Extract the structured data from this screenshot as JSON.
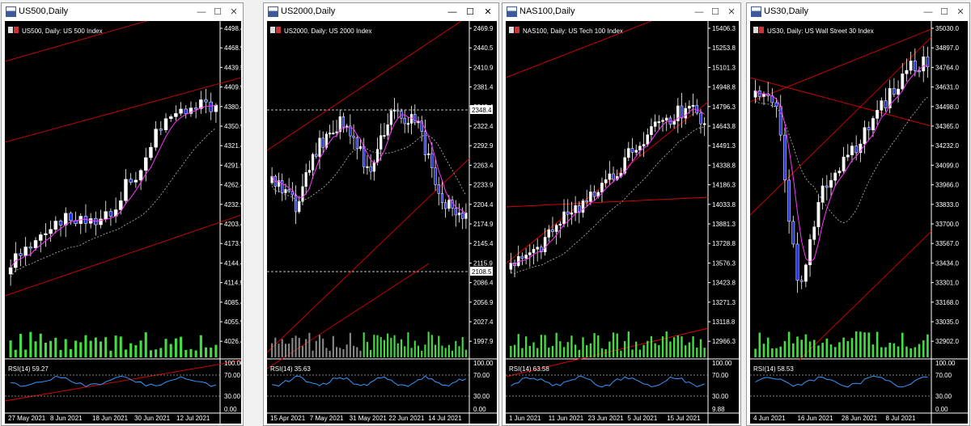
{
  "windows": [
    {
      "title": "US500,Daily",
      "active": false,
      "header": "US500, Daily:  US 500 Index",
      "price_labels": [
        "4498.4",
        "4468.9",
        "4439.5",
        "4409.9",
        "4380.4",
        "4350.9",
        "4321.4",
        "4291.9",
        "4262.4",
        "4232.9",
        "4203.4",
        "4173.9",
        "4144.4",
        "4114.9",
        "4085.4",
        "4055.9",
        "4026.4"
      ],
      "date_labels": [
        "27 May 2021",
        "8 Jun 2021",
        "18 Jun 2021",
        "30 Jun 2021",
        "12 Jul 2021"
      ],
      "rsi_label": "RSI(14) 59.27",
      "rsi_levels": [
        "100.00",
        "70.00",
        "30.00",
        "0.00"
      ],
      "tagged_levels": []
    },
    {
      "title": "US2000,Daily",
      "active": true,
      "header": "US2000, Daily:  US 2000 Index",
      "price_labels": [
        "2469.9",
        "2440.5",
        "2410.9",
        "2381.4",
        "2348.4",
        "2322.4",
        "2292.9",
        "2263.4",
        "2233.9",
        "2204.4",
        "2174.9",
        "2145.4",
        "2115.9",
        "2086.4",
        "2056.9",
        "2027.4",
        "1997.9"
      ],
      "date_labels": [
        "15 Apr 2021",
        "7 May 2021",
        "31 May 2021",
        "22 Jun 2021",
        "14 Jul 2021"
      ],
      "rsi_label": "RSI(14) 35.63",
      "rsi_levels": [
        "100.00",
        "70.00",
        "30.00",
        "0.00"
      ],
      "tagged_levels": [
        "2348.4",
        "2108.5"
      ]
    },
    {
      "title": "NAS100,Daily",
      "active": false,
      "header": "NAS100, Daily:  US Tech 100 Index",
      "price_labels": [
        "15406.3",
        "15253.8",
        "15101.3",
        "14948.8",
        "14796.3",
        "14643.8",
        "14491.3",
        "14338.8",
        "14186.3",
        "14033.8",
        "13881.3",
        "13728.8",
        "13576.3",
        "13423.8",
        "13271.3",
        "13118.8",
        "12966.3"
      ],
      "date_labels": [
        "1 Jun 2021",
        "11 Jun 2021",
        "23 Jun 2021",
        "5 Jul 2021",
        "15 Jul 2021"
      ],
      "rsi_label": "RSI(14) 63.58",
      "rsi_levels": [
        "100.00",
        "70.00",
        "30.00",
        "9.88"
      ],
      "tagged_levels": []
    },
    {
      "title": "US30,Daily",
      "active": false,
      "header": "US30, Daily:  US Wall Street 30 Index",
      "price_labels": [
        "35030.0",
        "34897.0",
        "34764.0",
        "34631.0",
        "34498.0",
        "34365.0",
        "34232.0",
        "34099.0",
        "33966.0",
        "33833.0",
        "33700.0",
        "33567.0",
        "33434.0",
        "33301.0",
        "33168.0",
        "33035.0",
        "32902.0"
      ],
      "date_labels": [
        "4 Jun 2021",
        "16 Jun 2021",
        "28 Jun 2021",
        "8 Jul 2021"
      ],
      "rsi_label": "RSI(14) 58.53",
      "rsi_levels": [
        "100.00",
        "70.00",
        "30.00",
        "0.00"
      ],
      "tagged_levels": []
    }
  ],
  "controls": {
    "minimize": "—",
    "maximize": "☐",
    "close": "✕"
  },
  "colors": {
    "bull": "#ffffff",
    "bear": "#2233dd",
    "ma_fast": "#ff33ff",
    "ma_slow": "#bbbbbb",
    "trend": "#dd0000",
    "rsi": "#3399ff",
    "volume_up": "#44dd44",
    "volume_old": "#888888"
  }
}
